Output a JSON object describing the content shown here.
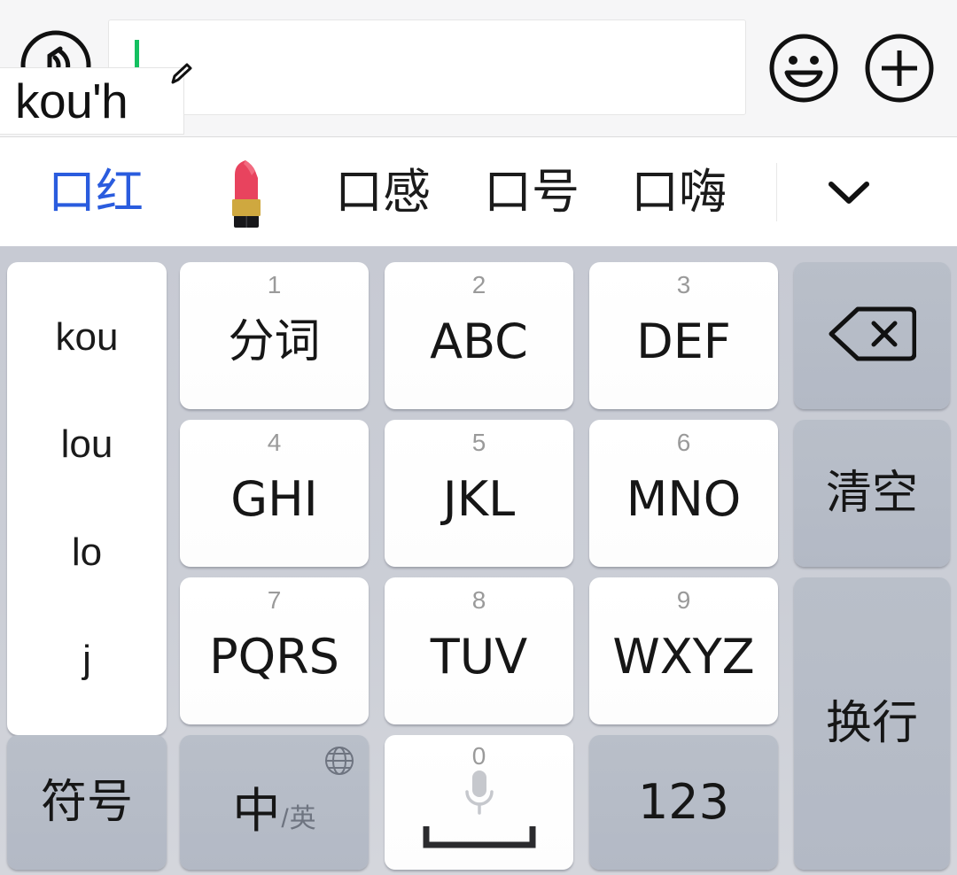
{
  "compose": {
    "voice_icon": "voice-wave-icon",
    "input_value": "",
    "input_placeholder": "",
    "composition_text": "kou'h",
    "pencil_icon": "pencil-edit-icon",
    "emoji_icon": "smiley-face-icon",
    "plus_icon": "plus-circle-icon",
    "caret_color": "#14c060"
  },
  "candidates": {
    "selected_color": "#2a5cde",
    "items": [
      {
        "label": "口红",
        "selected": true,
        "type": "text"
      },
      {
        "label": "💄",
        "selected": false,
        "type": "emoji"
      },
      {
        "label": "口感",
        "selected": false,
        "type": "text"
      },
      {
        "label": "口号",
        "selected": false,
        "type": "text"
      },
      {
        "label": "口嗨",
        "selected": false,
        "type": "text"
      }
    ],
    "expand_icon": "chevron-down-icon"
  },
  "keyboard": {
    "background_color": "#c9ccd4",
    "pinyin_options": [
      "kou",
      "lou",
      "lo",
      "j"
    ],
    "keys": [
      {
        "name": "key-1-fenci",
        "num": "1",
        "main": "分词",
        "style": "white",
        "cjk": true
      },
      {
        "name": "key-2-abc",
        "num": "2",
        "main": "ABC",
        "style": "white",
        "cjk": false
      },
      {
        "name": "key-3-def",
        "num": "3",
        "main": "DEF",
        "style": "white",
        "cjk": false
      },
      {
        "name": "key-4-ghi",
        "num": "4",
        "main": "GHI",
        "style": "white",
        "cjk": false
      },
      {
        "name": "key-5-jkl",
        "num": "5",
        "main": "JKL",
        "style": "white",
        "cjk": false
      },
      {
        "name": "key-6-mno",
        "num": "6",
        "main": "MNO",
        "style": "white",
        "cjk": false
      },
      {
        "name": "key-7-pqrs",
        "num": "7",
        "main": "PQRS",
        "style": "white",
        "cjk": false
      },
      {
        "name": "key-8-tuv",
        "num": "8",
        "main": "TUV",
        "style": "white",
        "cjk": false
      },
      {
        "name": "key-9-wxyz",
        "num": "9",
        "main": "WXYZ",
        "style": "white",
        "cjk": false
      }
    ],
    "backspace": {
      "label": "",
      "icon": "backspace-icon"
    },
    "clear": {
      "label": "清空"
    },
    "newline": {
      "label": "换行"
    },
    "symbols": {
      "label": "符号"
    },
    "lang_toggle": {
      "zh": "中",
      "slash": "/",
      "en": "英",
      "icon": "globe-icon"
    },
    "space": {
      "num": "0",
      "mic_icon": "microphone-icon",
      "bar_icon": "spacebar-icon"
    },
    "numeric": {
      "label": "123"
    }
  }
}
